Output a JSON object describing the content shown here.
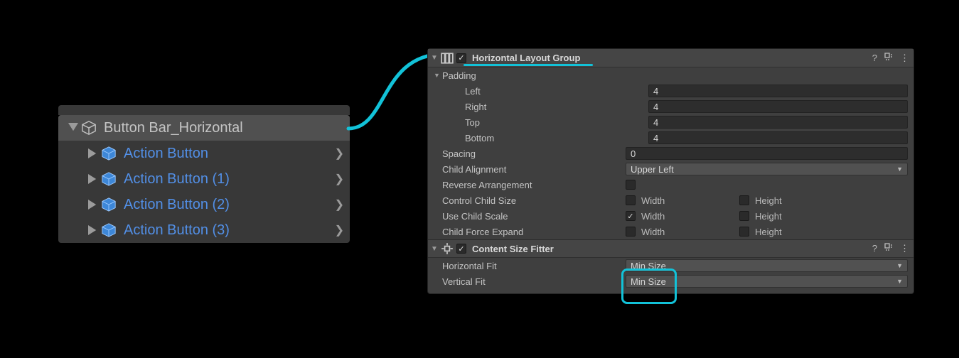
{
  "hierarchy": {
    "parent_label": "Button Bar_Horizontal",
    "children": [
      "Action Button",
      "Action Button (1)",
      "Action Button (2)",
      "Action Button (3)"
    ]
  },
  "inspector": {
    "hlg": {
      "title": "Horizontal Layout Group",
      "enabled": true,
      "padding_label": "Padding",
      "left_label": "Left",
      "right_label": "Right",
      "top_label": "Top",
      "bottom_label": "Bottom",
      "left": "4",
      "right": "4",
      "top": "4",
      "bottom": "4",
      "spacing_label": "Spacing",
      "spacing": "0",
      "child_align_label": "Child Alignment",
      "child_align": "Upper Left",
      "reverse_label": "Reverse Arrangement",
      "reverse": false,
      "control_label": "Control Child Size",
      "scale_label": "Use Child Scale",
      "expand_label": "Child Force Expand",
      "width_label": "Width",
      "height_label": "Height",
      "control_width": false,
      "control_height": false,
      "scale_width": true,
      "scale_height": false,
      "expand_width": false,
      "expand_height": false
    },
    "csf": {
      "title": "Content Size Fitter",
      "enabled": true,
      "hfit_label": "Horizontal Fit",
      "vfit_label": "Vertical Fit",
      "hfit": "Min Size",
      "vfit": "Min Size"
    }
  }
}
